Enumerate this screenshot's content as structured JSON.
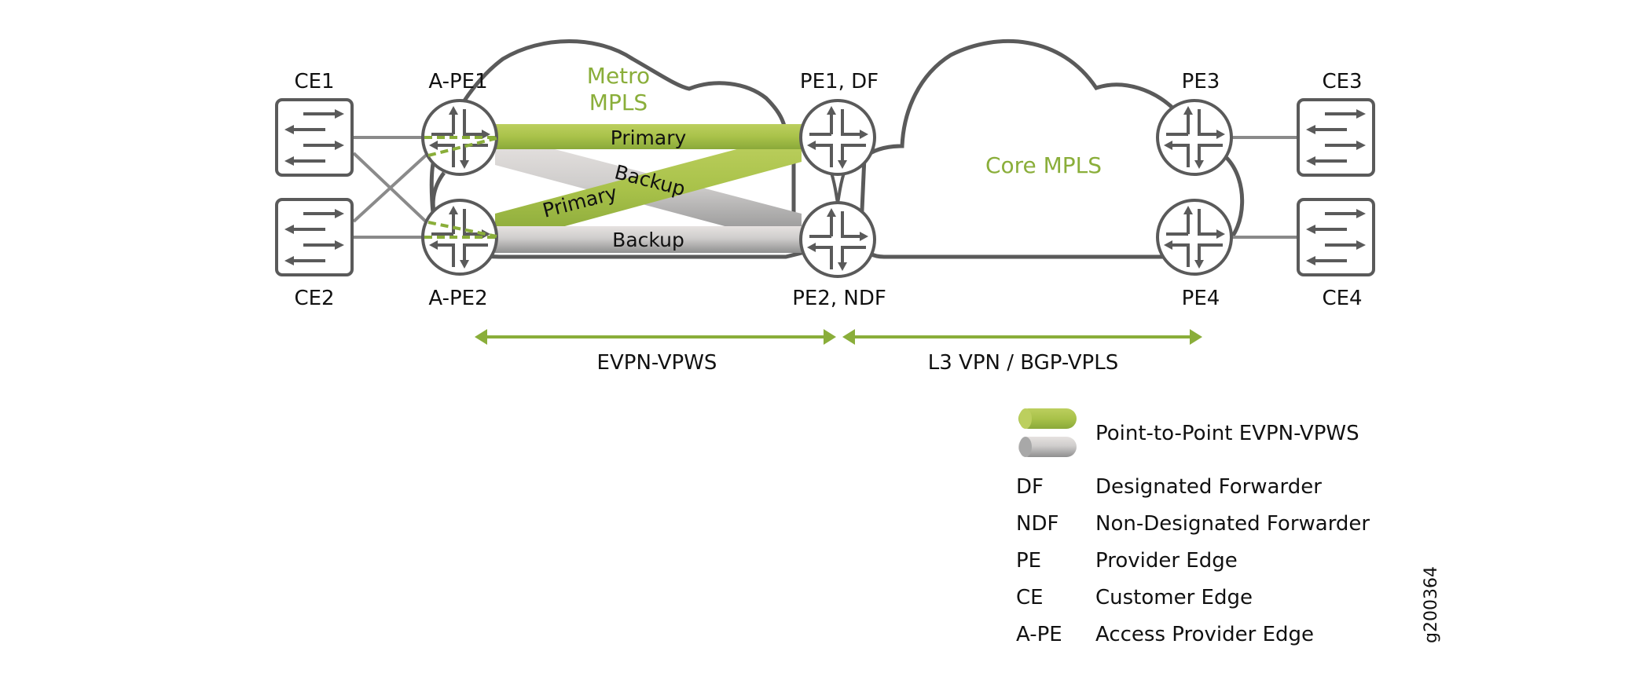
{
  "colors": {
    "green": "#a9c24a",
    "green_dark": "#8aae3a",
    "gray_tube": "#c4c4c4",
    "outline": "#5a5a5a",
    "link": "#8a8a8a"
  },
  "nodes": {
    "ce1": "CE1",
    "ce2": "CE2",
    "ce3": "CE3",
    "ce4": "CE4",
    "ape1": "A-PE1",
    "ape2": "A-PE2",
    "pe1": "PE1, DF",
    "pe2": "PE2, NDF",
    "pe3": "PE3",
    "pe4": "PE4"
  },
  "clouds": {
    "metro_line1": "Metro",
    "metro_line2": "MPLS",
    "core": "Core MPLS"
  },
  "tubes": {
    "primary_top": "Primary",
    "backup_diag": "Backup",
    "primary_diag": "Primary",
    "backup_bottom": "Backup"
  },
  "spans": {
    "left": "EVPN-VPWS",
    "right": "L3 VPN / BGP-VPLS"
  },
  "legend": {
    "tube_label": "Point-to-Point EVPN-VPWS",
    "items": [
      {
        "abbr": "DF",
        "text": "Designated Forwarder"
      },
      {
        "abbr": "NDF",
        "text": "Non-Designated Forwarder"
      },
      {
        "abbr": "PE",
        "text": "Provider Edge"
      },
      {
        "abbr": "CE",
        "text": "Customer Edge"
      },
      {
        "abbr": "A-PE",
        "text": "Access Provider Edge"
      }
    ]
  },
  "figure_id": "g200364"
}
